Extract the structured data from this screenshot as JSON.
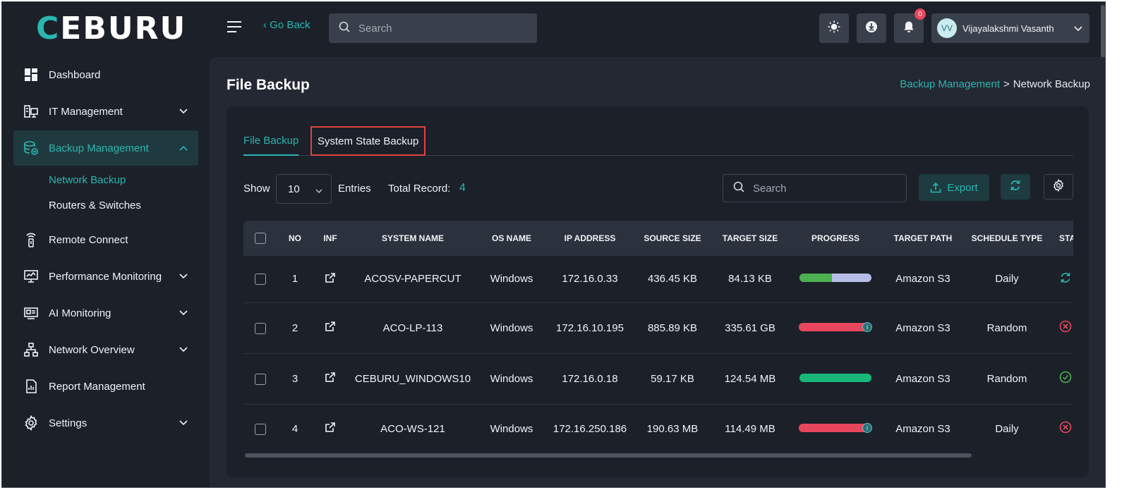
{
  "brand": {
    "logo_mark": "C",
    "logo_rest": "EBURU"
  },
  "sidebar": {
    "items": [
      {
        "label": "Dashboard",
        "icon": "dashboard-icon",
        "has_chevron": false
      },
      {
        "label": "IT Management",
        "icon": "it-management-icon",
        "has_chevron": true
      },
      {
        "label": "Backup Management",
        "icon": "backup-database-icon",
        "has_chevron": true,
        "active": true,
        "children": [
          {
            "label": "Network Backup",
            "active": true
          },
          {
            "label": "Routers & Switches"
          }
        ]
      },
      {
        "label": "Remote Connect",
        "icon": "remote-connect-icon",
        "has_chevron": false
      },
      {
        "label": "Performance Monitoring",
        "icon": "monitor-chart-icon",
        "has_chevron": true
      },
      {
        "label": "AI Monitoring",
        "icon": "ai-monitor-icon",
        "has_chevron": true
      },
      {
        "label": "Network Overview",
        "icon": "network-tree-icon",
        "has_chevron": true
      },
      {
        "label": "Report Management",
        "icon": "report-icon",
        "has_chevron": false
      },
      {
        "label": "Settings",
        "icon": "gear-icon",
        "has_chevron": true
      }
    ]
  },
  "header": {
    "go_back": "‹ Go Back",
    "search_placeholder": "Search",
    "notification_count": "0",
    "user": {
      "initials": "VV",
      "name": "Vijayalakshmi Vasanth"
    }
  },
  "page": {
    "title": "File Backup",
    "breadcrumb": {
      "parent": "Backup Management",
      "separator": ">",
      "current": "Network Backup"
    }
  },
  "tabs": [
    {
      "label": "File Backup",
      "active": true
    },
    {
      "label": "System State Backup",
      "active": false,
      "highlighted": true
    }
  ],
  "toolbar": {
    "show_label": "Show",
    "entries_value": "10",
    "entries_label": "Entries",
    "total_label": "Total Record:",
    "total_value": "4",
    "search_placeholder": "Search",
    "export_label": "Export"
  },
  "table": {
    "columns": [
      "NO",
      "INF",
      "SYSTEM NAME",
      "OS NAME",
      "IP ADDRESS",
      "SOURCE SIZE",
      "TARGET SIZE",
      "PROGRESS",
      "TARGET PATH",
      "SCHEDULE TYPE",
      "STATUS"
    ],
    "rows": [
      {
        "no": "1",
        "system_name": "ACOSV-PAPERCUT",
        "os_name": "Windows",
        "ip": "172.16.0.33",
        "source_size": "436.45 KB",
        "target_size": "84.13 KB",
        "progress": 0.45,
        "progress_color": "#4caf50",
        "progress_track": "#b7bde6",
        "progress_info": false,
        "target_path": "Amazon S3",
        "schedule_type": "Daily",
        "status_icon": "sync-icon",
        "status_color": "#2bb6b0"
      },
      {
        "no": "2",
        "system_name": "ACO-LP-113",
        "os_name": "Windows",
        "ip": "172.16.10.195",
        "source_size": "885.89 KB",
        "target_size": "335.61 GB",
        "progress": 1.0,
        "progress_color": "#e8465d",
        "progress_track": "#e8465d",
        "progress_info": true,
        "target_path": "Amazon S3",
        "schedule_type": "Random",
        "status_icon": "error-circle-icon",
        "status_color": "#e8465d"
      },
      {
        "no": "3",
        "system_name": "CEBURU_WINDOWS10",
        "os_name": "Windows",
        "ip": "172.16.0.18",
        "source_size": "59.17 KB",
        "target_size": "124.54 MB",
        "progress": 1.0,
        "progress_color": "#19b67a",
        "progress_track": "#19b67a",
        "progress_info": false,
        "target_path": "Amazon S3",
        "schedule_type": "Random",
        "status_icon": "success-circle-icon",
        "status_color": "#4caf50"
      },
      {
        "no": "4",
        "system_name": "ACO-WS-121",
        "os_name": "Windows",
        "ip": "172.16.250.186",
        "source_size": "190.63 MB",
        "target_size": "114.49 MB",
        "progress": 1.0,
        "progress_color": "#e8465d",
        "progress_track": "#e8465d",
        "progress_info": true,
        "target_path": "Amazon S3",
        "schedule_type": "Daily",
        "status_icon": "error-circle-icon",
        "status_color": "#e8465d"
      }
    ]
  },
  "colors": {
    "accent": "#2bb6b0",
    "highlight_box": "#e0443e"
  }
}
